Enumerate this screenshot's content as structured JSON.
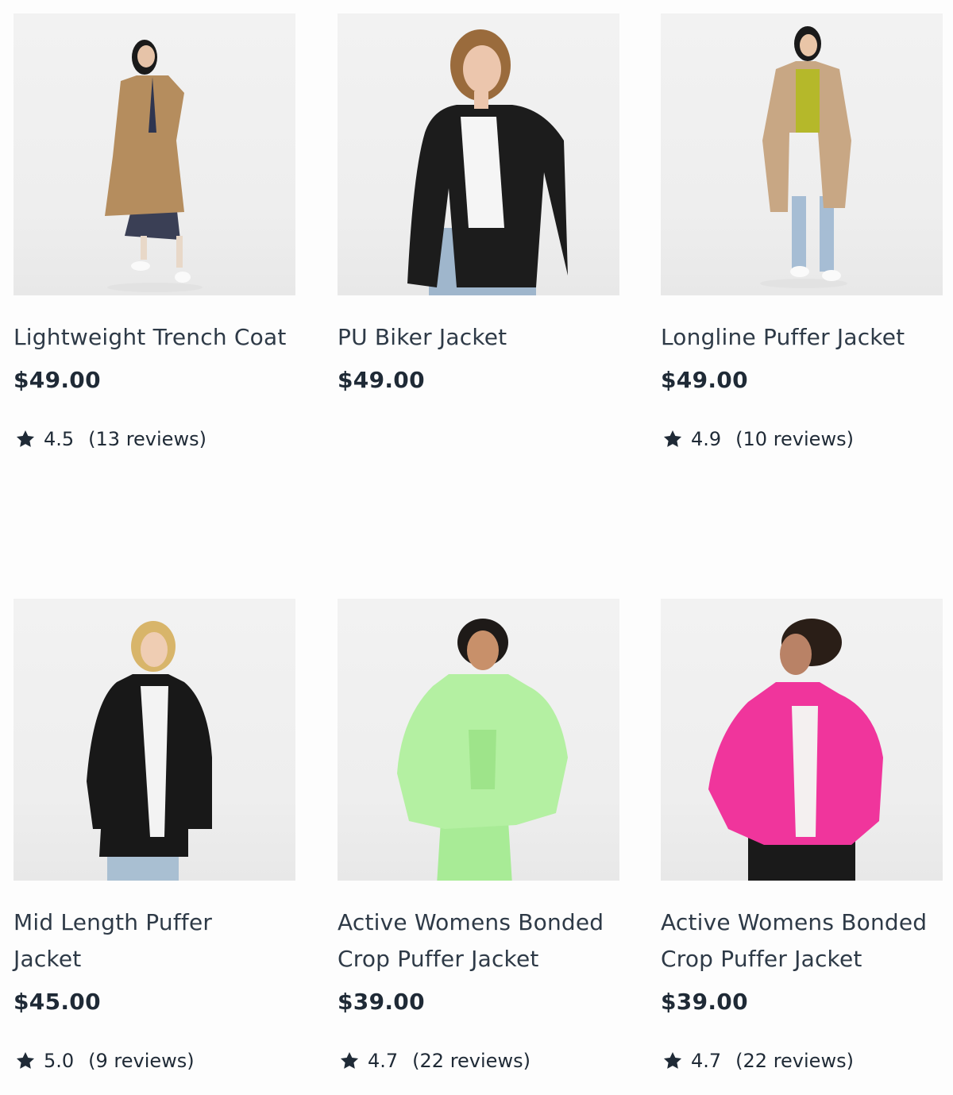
{
  "products": [
    {
      "title": "Lightweight Trench Coat",
      "price": "$49.00",
      "rating": "4.5",
      "reviews": "(13 reviews)",
      "image_icon": "woman-trench-coat-photo",
      "colors": {
        "garment": "#b58d5e",
        "bottom": "#3a3f55"
      }
    },
    {
      "title": "PU Biker Jacket",
      "price": "$49.00",
      "image_icon": "woman-biker-jacket-photo",
      "colors": {
        "garment": "#1c1c1c",
        "bottom": "#9fb6cc"
      }
    },
    {
      "title": "Longline Puffer Jacket",
      "price": "$49.00",
      "rating": "4.9",
      "reviews": "(10 reviews)",
      "image_icon": "woman-longline-puffer-photo",
      "colors": {
        "garment": "#c8a784",
        "bottom": "#a6bdd4"
      }
    },
    {
      "title": "Mid Length Puffer Jacket",
      "price": "$45.00",
      "rating": "5.0",
      "reviews": "(9 reviews)",
      "image_icon": "woman-mid-length-puffer-photo",
      "colors": {
        "garment": "#181818",
        "bottom": "#a9bfd2"
      }
    },
    {
      "title": "Active Womens Bonded Crop Puffer Jacket",
      "price": "$39.00",
      "rating": "4.7",
      "reviews": "(22 reviews)",
      "image_icon": "woman-green-crop-puffer-photo",
      "colors": {
        "garment": "#b4f0a2",
        "bottom": "#a8eb96"
      }
    },
    {
      "title": "Active Womens Bonded Crop Puffer Jacket",
      "price": "$39.00",
      "rating": "4.7",
      "reviews": "(22 reviews)",
      "image_icon": "woman-pink-crop-puffer-photo",
      "colors": {
        "garment": "#f0359c",
        "bottom": "#1a1a1a"
      }
    }
  ],
  "icons": {
    "rating": "star-icon"
  }
}
